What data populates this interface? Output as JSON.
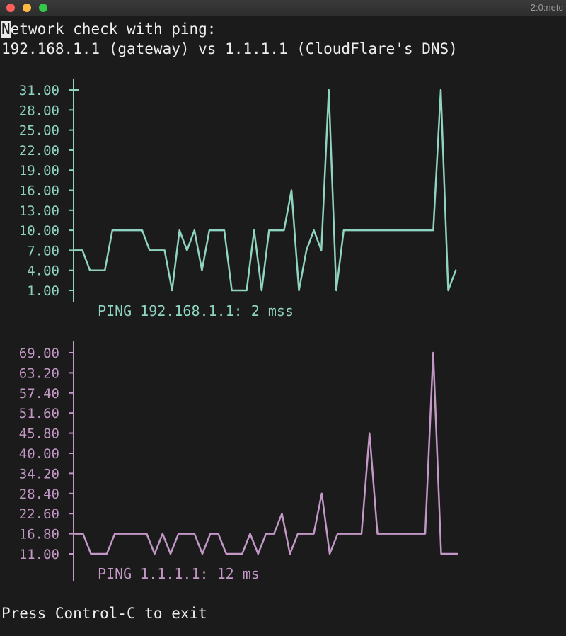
{
  "window": {
    "title": "2:0:netc"
  },
  "terminal": {
    "header_cursor_char": "N",
    "header_line1_rest": "etwork check with ping:",
    "header_line2": "192.168.1.1 (gateway) vs 1.1.1.1 (CloudFlare's DNS)",
    "footer": "Press Control-C to exit"
  },
  "colors": {
    "gateway": "#8fd3c1",
    "dns": "#c397c6",
    "text": "#eeeeee",
    "background": "#1b1b1b"
  },
  "chart_data": [
    {
      "type": "line",
      "title": "",
      "caption": "PING 192.168.1.1: 2 mss",
      "color": "#8fd3c1",
      "y_ticks": [
        "31.00",
        "28.00",
        "25.00",
        "22.00",
        "19.00",
        "16.00",
        "13.00",
        "10.00",
        "7.00",
        "4.00",
        "1.00"
      ],
      "ylim": [
        1,
        31
      ],
      "series": [
        {
          "values": [
            7,
            7,
            4,
            4,
            4,
            10,
            10,
            10,
            10,
            10,
            7,
            7,
            7,
            1,
            10,
            7,
            10,
            4,
            10,
            10,
            10,
            1,
            1,
            1,
            10,
            1,
            10,
            10,
            10,
            16,
            1,
            7,
            10,
            7,
            31,
            1,
            10,
            10,
            10,
            10,
            10,
            10,
            10,
            10,
            10,
            10,
            10,
            10,
            10,
            31,
            1,
            4
          ]
        }
      ]
    },
    {
      "type": "line",
      "title": "",
      "caption": "PING 1.1.1.1: 12 ms",
      "color": "#c397c6",
      "y_ticks": [
        "69.00",
        "63.20",
        "57.40",
        "51.60",
        "45.80",
        "40.00",
        "34.20",
        "28.40",
        "22.60",
        "16.80",
        "11.00"
      ],
      "ylim": [
        11,
        69
      ],
      "series": [
        {
          "values": [
            16.8,
            16.8,
            11,
            11,
            11,
            16.8,
            16.8,
            16.8,
            16.8,
            16.8,
            11,
            16.8,
            11,
            16.8,
            16.8,
            16.8,
            11,
            16.8,
            16.8,
            11,
            11,
            11,
            16.8,
            11,
            16.8,
            16.8,
            22.6,
            11,
            16.8,
            16.8,
            16.8,
            28.4,
            11,
            16.8,
            16.8,
            16.8,
            16.8,
            45.8,
            16.8,
            16.8,
            16.8,
            16.8,
            16.8,
            16.8,
            16.8,
            69,
            11,
            11,
            11
          ]
        }
      ]
    }
  ]
}
